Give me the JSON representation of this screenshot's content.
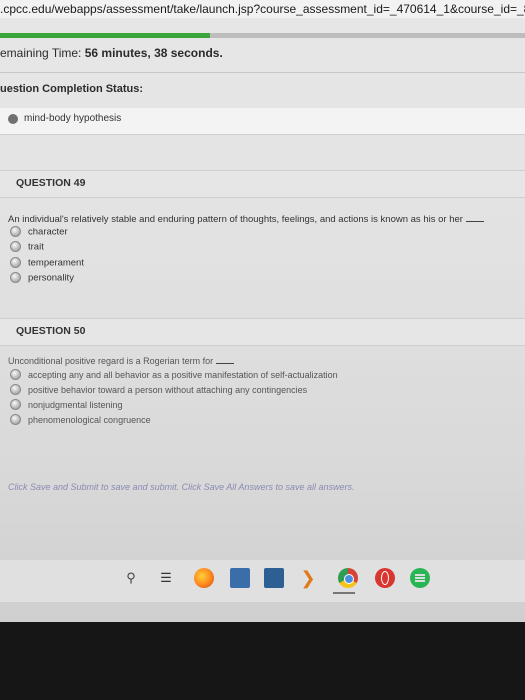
{
  "url": ".cpcc.edu/webapps/assessment/take/launch.jsp?course_assessment_id=_470614_1&course_id=_81",
  "timer": {
    "label": "emaining Time:",
    "value": "56 minutes, 38 seconds."
  },
  "progress": {
    "fraction": 0.4
  },
  "completion": {
    "title": "uestion Completion Status:",
    "item": "mind-body hypothesis"
  },
  "questions": [
    {
      "heading": "QUESTION 49",
      "text": "An individual's relatively stable and enduring pattern of thoughts, feelings, and actions is known as his or her",
      "options": [
        "character",
        "trait",
        "temperament",
        "personality"
      ]
    },
    {
      "heading": "QUESTION 50",
      "text": "Unconditional positive regard is a Rogerian term for",
      "options": [
        "accepting any and all behavior as a positive manifestation of self-actualization",
        "positive behavior toward a person without attaching any contingencies",
        "nonjudgmental listening",
        "phenomenological congruence"
      ]
    }
  ],
  "save_note": "Click Save and Submit to save and submit. Click Save All Answers to save all answers.",
  "taskbar": {
    "icons": [
      "search-icon",
      "task-view-icon",
      "firefox-icon",
      "store-icon",
      "photos-icon",
      "arrow-icon",
      "chrome-icon",
      "opera-icon",
      "spotify-icon"
    ]
  }
}
